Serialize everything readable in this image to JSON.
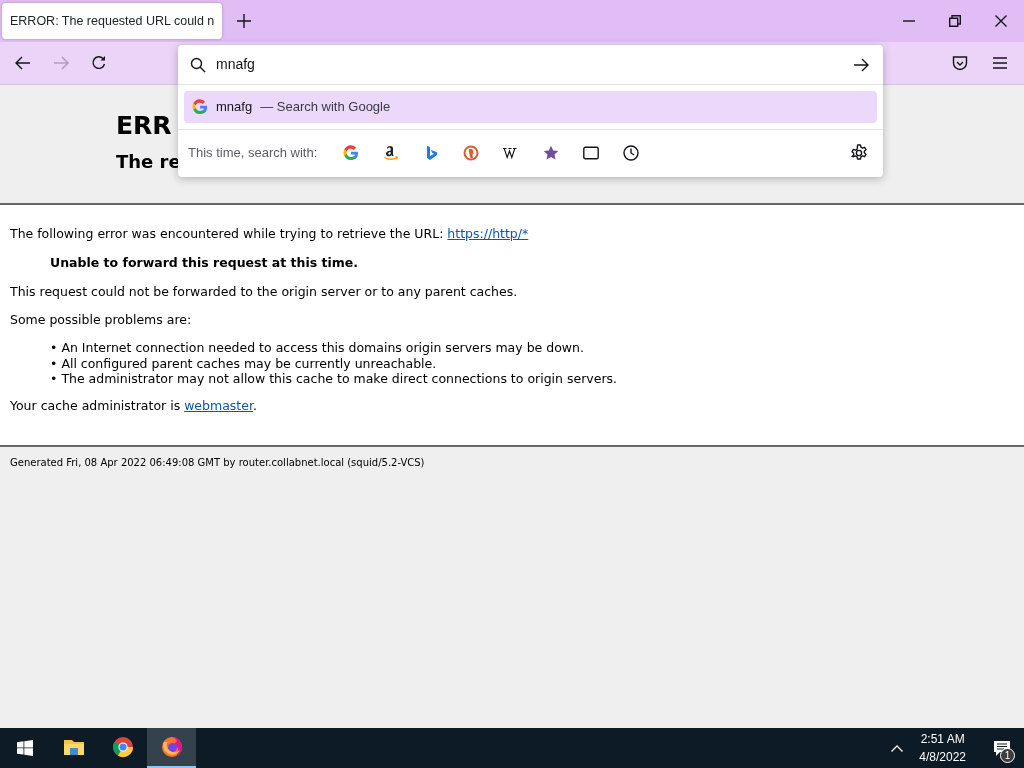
{
  "tab": {
    "title": "ERROR: The requested URL could n",
    "selected": true
  },
  "urlbar": {
    "value": "mnafg"
  },
  "suggestions": [
    {
      "query": "mnafg",
      "separator": "—",
      "label": "Search with Google",
      "selected": true
    }
  ],
  "one_offs": {
    "label": "This time, search with:"
  },
  "page": {
    "heading": "ERR",
    "subheading": "The re",
    "intro": {
      "text": "The following error was encountered while trying to retrieve the URL: ",
      "link": "https://http/*"
    },
    "reason": "Unable to forward this request at this time.",
    "detail": "This request could not be forwarded to the origin server or to any parent caches.",
    "problems_label": "Some possible problems are:",
    "problems": [
      {
        "marker": "•",
        "text": "An Internet connection needed to access this domains origin servers may be down."
      },
      {
        "marker": "•",
        "text": "All configured parent caches may be currently unreachable."
      },
      {
        "marker": "•",
        "text": "The administrator may not allow this cache to make direct connections to origin servers."
      }
    ],
    "admin": {
      "text": "Your cache administrator is ",
      "link": "webmaster",
      "after": "."
    },
    "footer": "Generated Fri, 08 Apr 2022 06:49:08 GMT by router.collabnet.local (squid/5.2-VCS)"
  },
  "taskbar": {
    "apps": [
      {
        "kind": "explorer",
        "selected": false
      },
      {
        "kind": "chrome",
        "selected": false
      },
      {
        "kind": "firefox",
        "selected": true
      }
    ],
    "time": "2:51 AM",
    "date": "4/8/2022",
    "notifications": "1"
  }
}
